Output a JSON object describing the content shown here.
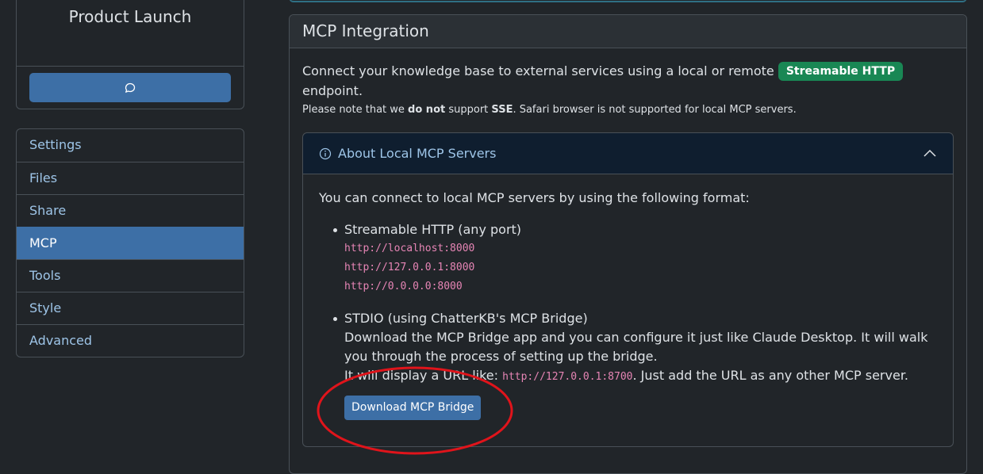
{
  "kb": {
    "title": "Product Launch",
    "chat_icon": "chat-bubble-icon"
  },
  "sidebar": {
    "items": [
      {
        "label": "Settings",
        "active": false
      },
      {
        "label": "Files",
        "active": false
      },
      {
        "label": "Share",
        "active": false
      },
      {
        "label": "MCP",
        "active": true
      },
      {
        "label": "Tools",
        "active": false
      },
      {
        "label": "Style",
        "active": false
      },
      {
        "label": "Advanced",
        "active": false
      }
    ]
  },
  "mcp": {
    "title": "MCP Integration",
    "intro_before": "Connect your knowledge base to external services using a local or remote",
    "badge": "Streamable HTTP",
    "intro_after": "endpoint.",
    "note_1": "Please note that we",
    "note_bold_1": "do not",
    "note_2": "support",
    "note_bold_2": "SSE",
    "note_3": ". Safari browser is not supported for local MCP servers.",
    "accordion": {
      "title": "About Local MCP Servers",
      "info_icon": "info-circle-icon",
      "toggle_icon": "chevron-up-icon",
      "intro": "You can connect to local MCP servers by using the following format:",
      "http": {
        "title": "Streamable HTTP (any port)",
        "urls": [
          "http://localhost:8000",
          "http://127.0.0.1:8000",
          "http://0.0.0.0:8000"
        ]
      },
      "stdio": {
        "title": "STDIO (using ChatterKB's MCP Bridge)",
        "desc": "Download the MCP Bridge app and you can configure it just like Claude Desktop. It will walk you through the process of setting up the bridge.",
        "display_before": "It will display a URL like:",
        "display_url": "http://127.0.0.1:8700",
        "display_after": ". Just add the URL as any other MCP server."
      },
      "download_button": "Download MCP Bridge"
    }
  },
  "colors": {
    "accent": "#3d6fa6",
    "badge": "#198754",
    "code": "#e685b5",
    "annotation": "#e0141b"
  }
}
